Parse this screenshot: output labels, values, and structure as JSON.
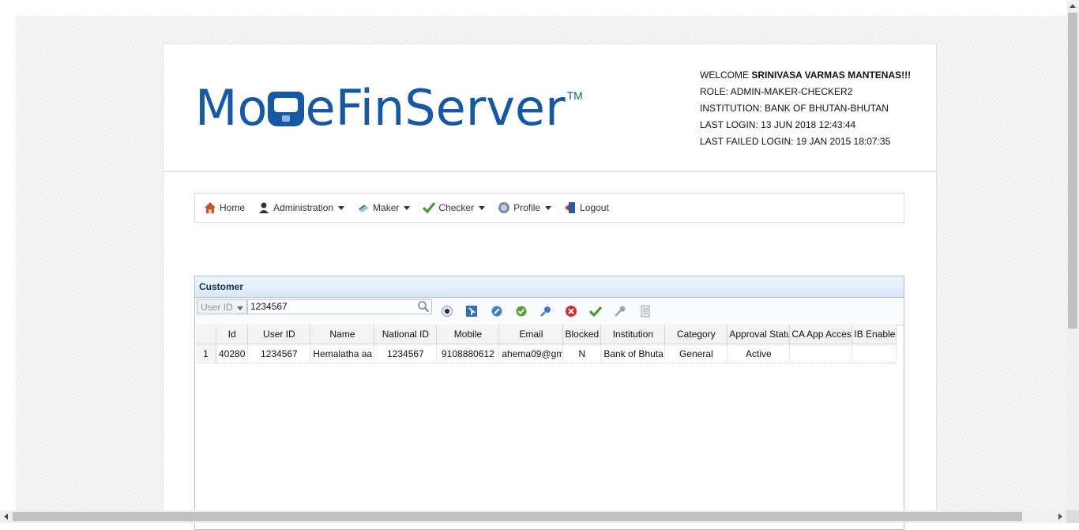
{
  "brand": {
    "logo_text_before": "Mo",
    "logo_text_after": "eFinServer",
    "tm": "TM",
    "accent": "#1558a6"
  },
  "user_info": {
    "welcome_prefix": "WELCOME ",
    "welcome_name": "SRINIVASA VARMAS MANTENAS!!!",
    "role": "ROLE: ADMIN-MAKER-CHECKER2",
    "institution": "INSTITUTION: BANK OF BHUTAN-BHUTAN",
    "last_login": "LAST LOGIN: 13 JUN 2018 12:43:44",
    "last_failed_login": "LAST FAILED LOGIN: 19 JAN 2015 18:07:35"
  },
  "nav": {
    "home": "Home",
    "administration": "Administration",
    "maker": "Maker",
    "checker": "Checker",
    "profile": "Profile",
    "logout": "Logout"
  },
  "grid": {
    "title": "Customer",
    "search_field": "User ID",
    "search_value": "1234567",
    "columns": [
      "Id",
      "User ID",
      "Name",
      "National ID",
      "Mobile",
      "Email",
      "Blocked",
      "Institution",
      "Category",
      "Approval Status",
      "CA App Access",
      "IB Enable"
    ],
    "rows": [
      {
        "num": "1",
        "cells": [
          "40280",
          "1234567",
          "Hemalatha aa",
          "1234567",
          "9108880612",
          "ahema09@gm",
          "N",
          "Bank of Bhuta",
          "General",
          "Active",
          "",
          ""
        ]
      }
    ]
  },
  "toolbar_icons": [
    "view-icon",
    "export-icon",
    "edit-icon",
    "approve-icon",
    "key-icon",
    "delete-icon",
    "check-icon",
    "wrench-icon",
    "report-icon"
  ]
}
